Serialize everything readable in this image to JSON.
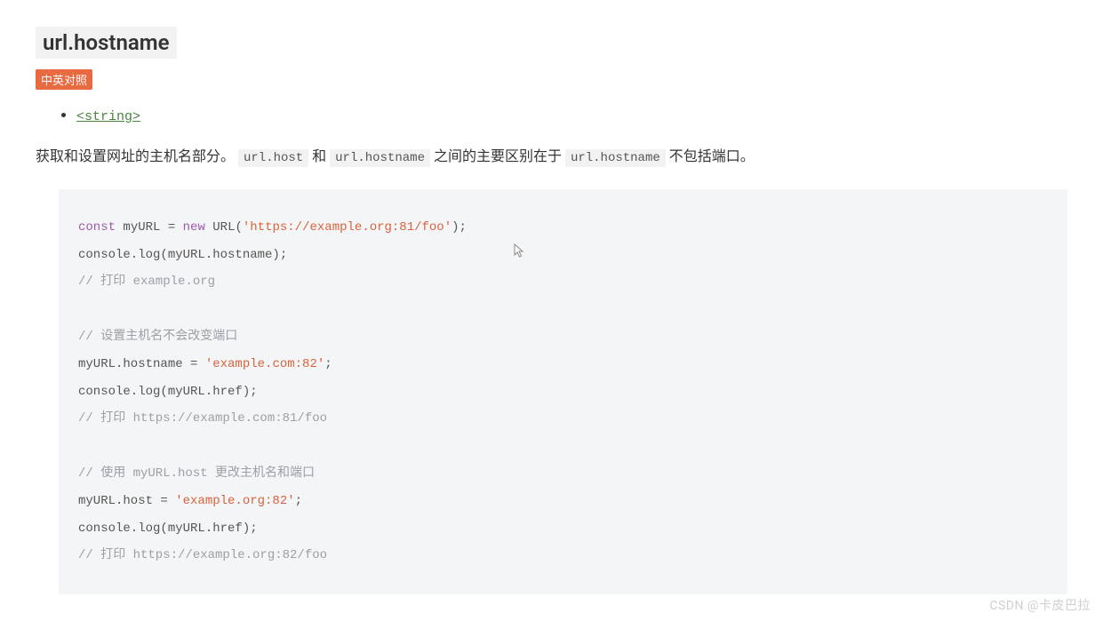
{
  "heading": "url.hostname",
  "badge": "中英对照",
  "typeLink": "<string>",
  "description": {
    "part1": "获取和设置网址的主机名部分。 ",
    "code1": "url.host",
    "mid1": " 和 ",
    "code2": "url.hostname",
    "mid2": " 之间的主要区别在于 ",
    "code3": "url.hostname",
    "part2": " 不包括端口。"
  },
  "code": {
    "l1_kw": "const",
    "l1_a": " myURL = ",
    "l1_kw2": "new",
    "l1_b": " URL(",
    "l1_str": "'https://example.org:81/foo'",
    "l1_c": ");",
    "l2": "console.log(myURL.hostname);",
    "l3_cmt": "// 打印 example.org",
    "l4_cmt": "// 设置主机名不会改变端口",
    "l5_a": "myURL.hostname = ",
    "l5_str": "'example.com:82'",
    "l5_b": ";",
    "l6": "console.log(myURL.href);",
    "l7_cmt": "// 打印 https://example.com:81/foo",
    "l8_cmt": "// 使用 myURL.host 更改主机名和端口",
    "l9_a": "myURL.host = ",
    "l9_str": "'example.org:82'",
    "l9_b": ";",
    "l10": "console.log(myURL.href);",
    "l11_cmt": "// 打印 https://example.org:82/foo"
  },
  "watermark": "CSDN @卡皮巴拉"
}
